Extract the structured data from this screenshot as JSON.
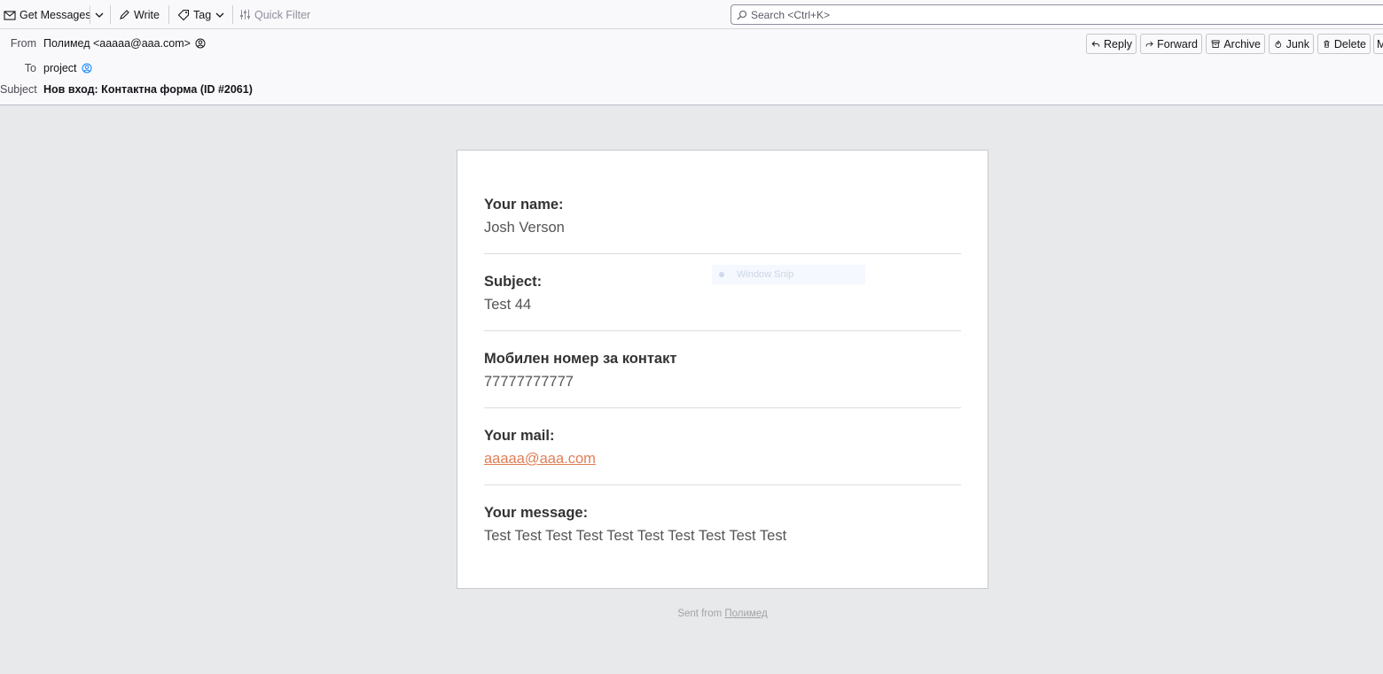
{
  "toolbar": {
    "get_messages": "Get Messages",
    "write": "Write",
    "tag": "Tag",
    "quick_filter": "Quick Filter",
    "search_placeholder": "Search <Ctrl+K>"
  },
  "header": {
    "from_label": "From",
    "from_value": "Полимед <aaaaa@aaa.com>",
    "to_label": "To",
    "to_value": "project",
    "subject_label": "Subject",
    "subject_value": "Нов вход: Контактна форма (ID #2061)",
    "actions": {
      "reply": "Reply",
      "forward": "Forward",
      "archive": "Archive",
      "junk": "Junk",
      "delete": "Delete",
      "more": "M"
    }
  },
  "message": {
    "fields": [
      {
        "label": "Your name:",
        "value": "Josh Verson"
      },
      {
        "label": "Subject:",
        "value": "Test 44"
      },
      {
        "label": "Мобилен номер за контакт",
        "value": "77777777777"
      },
      {
        "label": "Your mail:",
        "value": "aaaaa@aaa.com"
      },
      {
        "label": "Your message:",
        "value": "Test Test Test Test Test Test Test Test Test Test"
      }
    ],
    "footer_prefix": "Sent from",
    "footer_link": "Полимед"
  },
  "overlay": {
    "snip_label": "Window Snip"
  },
  "colors": {
    "background": "#e8e9eb",
    "card": "#ffffff",
    "link": "#e17d55",
    "toolbar": "#f9f9fb"
  }
}
